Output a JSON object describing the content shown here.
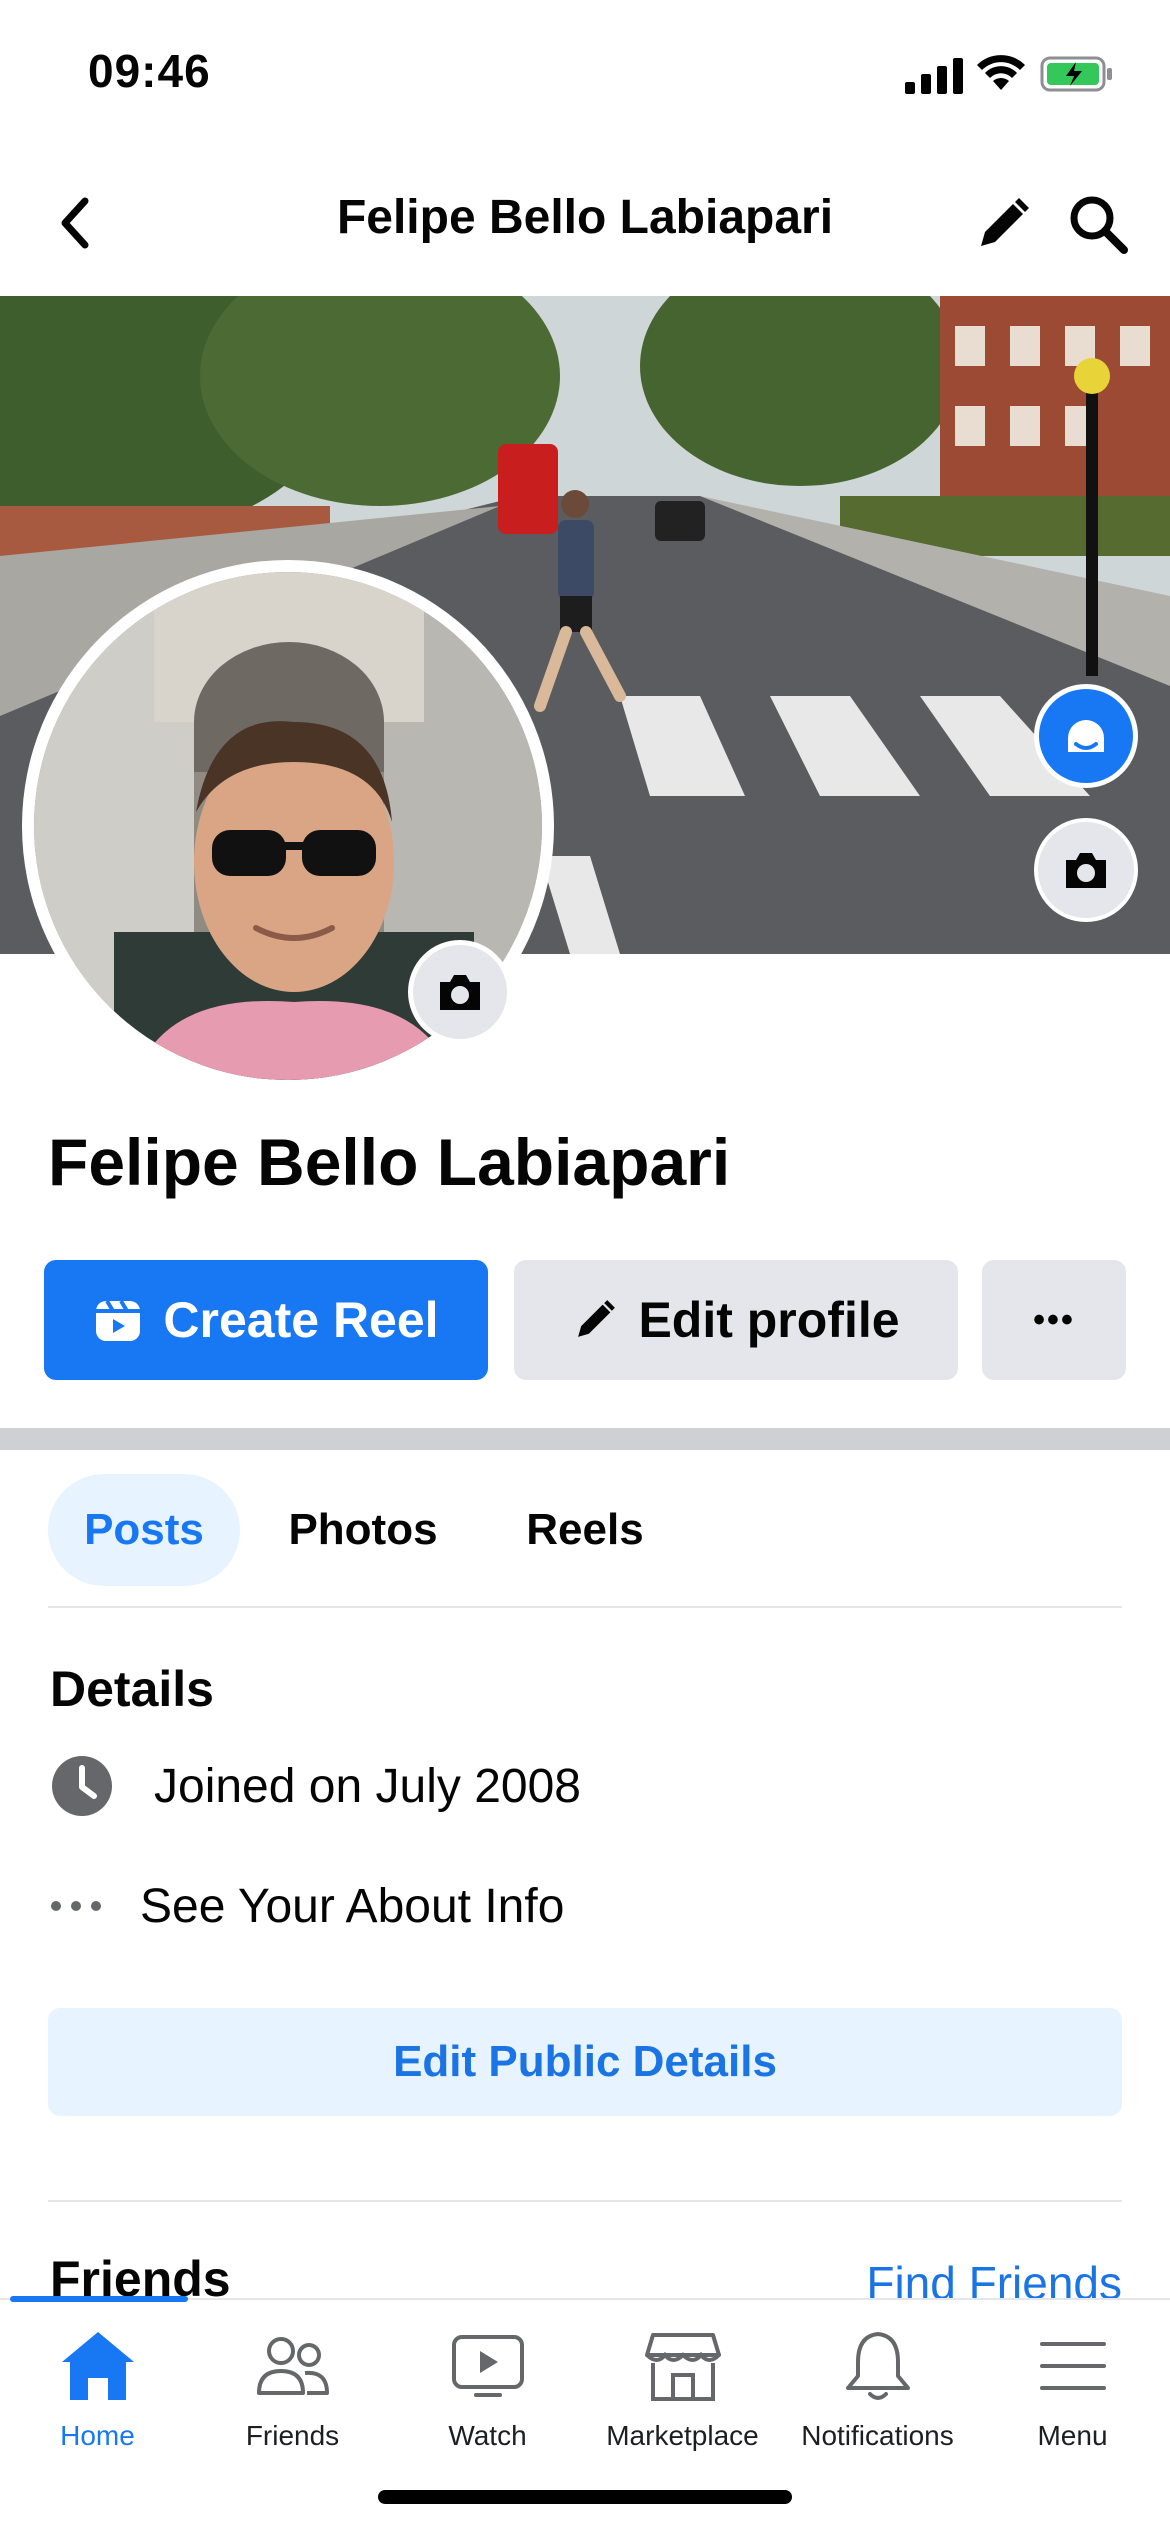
{
  "status_bar": {
    "time": "09:46",
    "icons": [
      "signal-icon",
      "wifi-icon",
      "battery-charging-icon"
    ]
  },
  "header": {
    "title": "Felipe Bello Labiapari",
    "icons": [
      "back-arrow-icon",
      "pencil-icon",
      "search-icon"
    ]
  },
  "profile": {
    "name": "Felipe Bello Labiapari"
  },
  "actions": {
    "create_reel": "Create Reel",
    "edit_profile": "Edit profile",
    "more": "•••"
  },
  "tabs": [
    {
      "label": "Posts",
      "active": true
    },
    {
      "label": "Photos",
      "active": false
    },
    {
      "label": "Reels",
      "active": false
    }
  ],
  "details": {
    "title": "Details",
    "joined": "Joined on July 2008",
    "about": "See Your About Info",
    "edit_public": "Edit Public Details"
  },
  "friends": {
    "title": "Friends",
    "find_friends": "Find Friends"
  },
  "tabbar": [
    {
      "label": "Home",
      "icon": "home-icon",
      "active": true
    },
    {
      "label": "Friends",
      "icon": "friends-icon",
      "active": false
    },
    {
      "label": "Watch",
      "icon": "watch-icon",
      "active": false
    },
    {
      "label": "Marketplace",
      "icon": "marketplace-icon",
      "active": false
    },
    {
      "label": "Notifications",
      "icon": "bell-icon",
      "active": false
    },
    {
      "label": "Menu",
      "icon": "menu-icon",
      "active": false
    }
  ],
  "colors": {
    "brand_blue": "#1877F2",
    "link_blue": "#1B74E4",
    "light_blue_bg": "#E7F3FF",
    "gray_button": "#E4E6EB"
  }
}
